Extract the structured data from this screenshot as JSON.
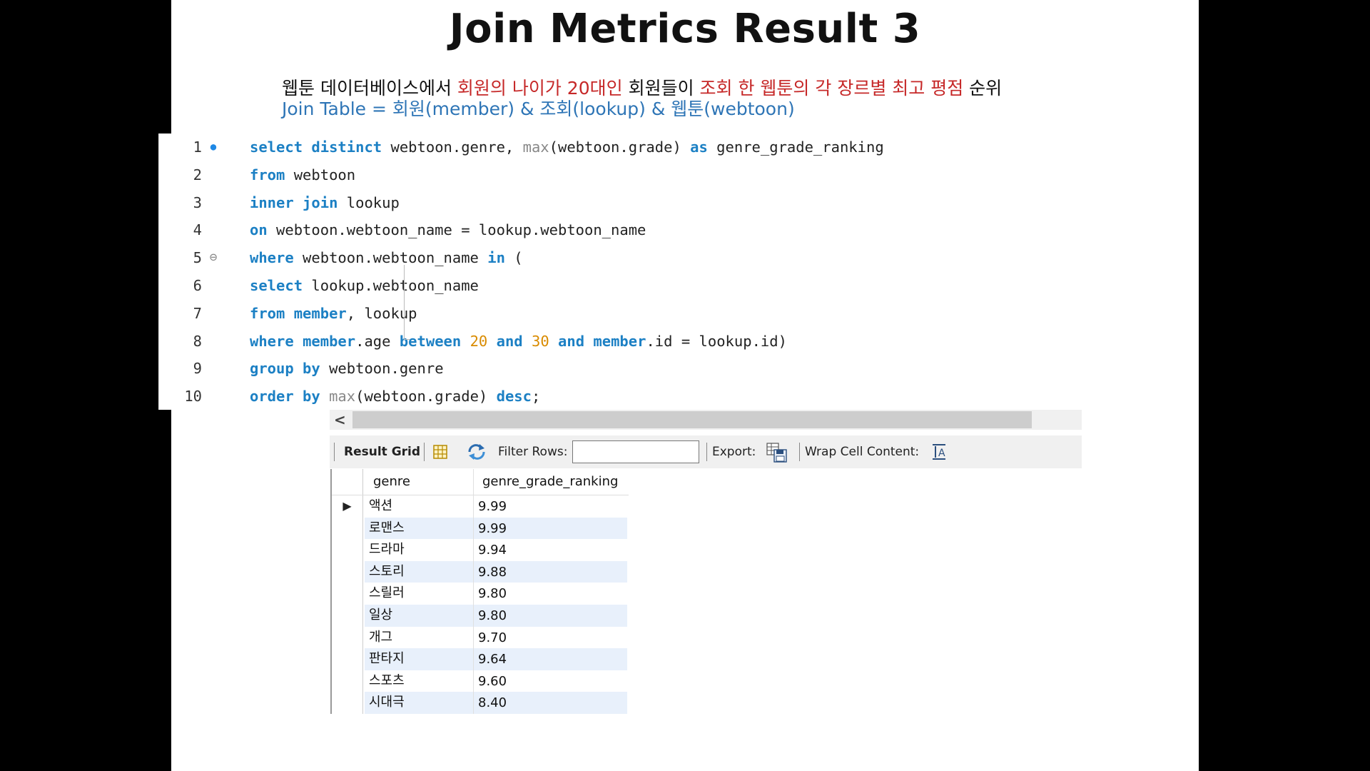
{
  "slide": {
    "title": "Join Metrics Result 3",
    "subtitle": {
      "p1": "웹툰 데이터베이스에서 ",
      "p2": "회원의 나이가 20대인",
      "p3": " 회원들이 ",
      "p4": "조회 한 웹툰의 각 장르별 최고 평점",
      "p5": " 순위"
    },
    "join_table": "Join Table =  회원(member) & 조회(lookup) & 웹툰(webtoon)"
  },
  "editor": {
    "line_numbers": [
      "1",
      "2",
      "3",
      "4",
      "5",
      "6",
      "7",
      "8",
      "9",
      "10"
    ],
    "lines": [
      [
        {
          "t": "select distinct",
          "k": "kw"
        },
        {
          "t": " webtoon.genre, ",
          "k": ""
        },
        {
          "t": "max",
          "k": "fn"
        },
        {
          "t": "(webtoon.grade) ",
          "k": ""
        },
        {
          "t": "as",
          "k": "kw"
        },
        {
          "t": " genre_grade_ranking",
          "k": ""
        }
      ],
      [
        {
          "t": "from",
          "k": "kw"
        },
        {
          "t": " webtoon",
          "k": ""
        }
      ],
      [
        {
          "t": "inner join",
          "k": "kw"
        },
        {
          "t": " lookup",
          "k": ""
        }
      ],
      [
        {
          "t": "on",
          "k": "kw"
        },
        {
          "t": " webtoon.webtoon_name = lookup.webtoon_name",
          "k": ""
        }
      ],
      [
        {
          "t": "where",
          "k": "kw"
        },
        {
          "t": " webtoon.webtoon_name ",
          "k": ""
        },
        {
          "t": "in",
          "k": "kw"
        },
        {
          "t": " (",
          "k": ""
        }
      ],
      [
        {
          "t": "select",
          "k": "kw"
        },
        {
          "t": " lookup.webtoon_name",
          "k": ""
        }
      ],
      [
        {
          "t": "from",
          "k": "kw"
        },
        {
          "t": " ",
          "k": ""
        },
        {
          "t": "member",
          "k": "kw"
        },
        {
          "t": ", lookup",
          "k": ""
        }
      ],
      [
        {
          "t": "where",
          "k": "kw"
        },
        {
          "t": " ",
          "k": ""
        },
        {
          "t": "member",
          "k": "kw"
        },
        {
          "t": ".age ",
          "k": ""
        },
        {
          "t": "between",
          "k": "kw"
        },
        {
          "t": " ",
          "k": ""
        },
        {
          "t": "20",
          "k": "num"
        },
        {
          "t": " ",
          "k": ""
        },
        {
          "t": "and",
          "k": "kw"
        },
        {
          "t": " ",
          "k": ""
        },
        {
          "t": "30",
          "k": "num"
        },
        {
          "t": " ",
          "k": ""
        },
        {
          "t": "and",
          "k": "kw"
        },
        {
          "t": " ",
          "k": ""
        },
        {
          "t": "member",
          "k": "kw"
        },
        {
          "t": ".id = lookup.id)",
          "k": ""
        }
      ],
      [
        {
          "t": "group by",
          "k": "kw"
        },
        {
          "t": " webtoon.genre",
          "k": ""
        }
      ],
      [
        {
          "t": "order by",
          "k": "kw"
        },
        {
          "t": " ",
          "k": ""
        },
        {
          "t": "max",
          "k": "fn"
        },
        {
          "t": "(webtoon.grade) ",
          "k": ""
        },
        {
          "t": "desc",
          "k": "kw"
        },
        {
          "t": ";",
          "k": ""
        }
      ]
    ],
    "colors": {
      "keyword": "#1c80c4",
      "function": "#888888",
      "number": "#d98b00",
      "text": "#222222"
    }
  },
  "toolbar": {
    "result_grid": "Result Grid",
    "filter_rows": "Filter Rows:",
    "filter_value": "",
    "export": "Export:",
    "wrap_cell": "Wrap Cell Content:"
  },
  "grid": {
    "headers": [
      "genre",
      "genre_grade_ranking"
    ],
    "rows": [
      [
        "액션",
        "9.99"
      ],
      [
        "로맨스",
        "9.99"
      ],
      [
        "드라마",
        "9.94"
      ],
      [
        "스토리",
        "9.88"
      ],
      [
        "스릴러",
        "9.80"
      ],
      [
        "일상",
        "9.80"
      ],
      [
        "개그",
        "9.70"
      ],
      [
        "판타지",
        "9.64"
      ],
      [
        "스포츠",
        "9.60"
      ],
      [
        "시대극",
        "8.40"
      ]
    ]
  }
}
